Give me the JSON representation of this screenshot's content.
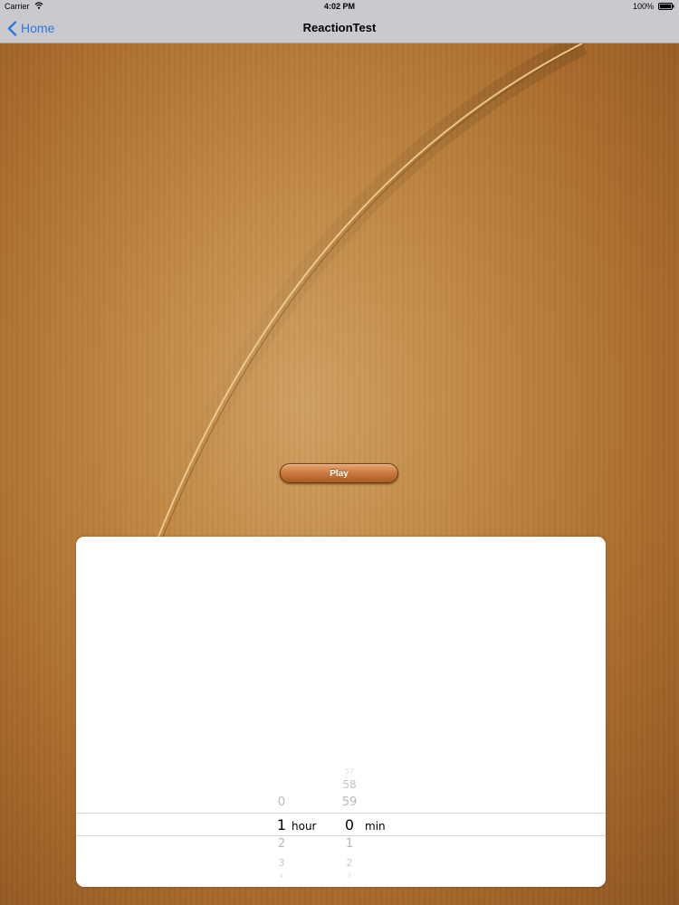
{
  "status_bar": {
    "carrier": "Carrier",
    "time": "4:02 PM",
    "battery": "100%"
  },
  "nav_bar": {
    "back_label": "Home",
    "title": "ReactionTest"
  },
  "play_button": {
    "label": "Play"
  },
  "picker": {
    "hour_column": {
      "above": [
        "0"
      ],
      "selected": "1",
      "below": [
        "2",
        "3",
        "4"
      ],
      "unit": "hour"
    },
    "minute_column": {
      "above": [
        "57",
        "58",
        "59"
      ],
      "selected": "0",
      "below": [
        "1",
        "2",
        "3"
      ],
      "unit": "min"
    }
  },
  "colors": {
    "nav_bar": "#c9c9ce",
    "link": "#2a7ae2",
    "wood": "#b77a33"
  }
}
